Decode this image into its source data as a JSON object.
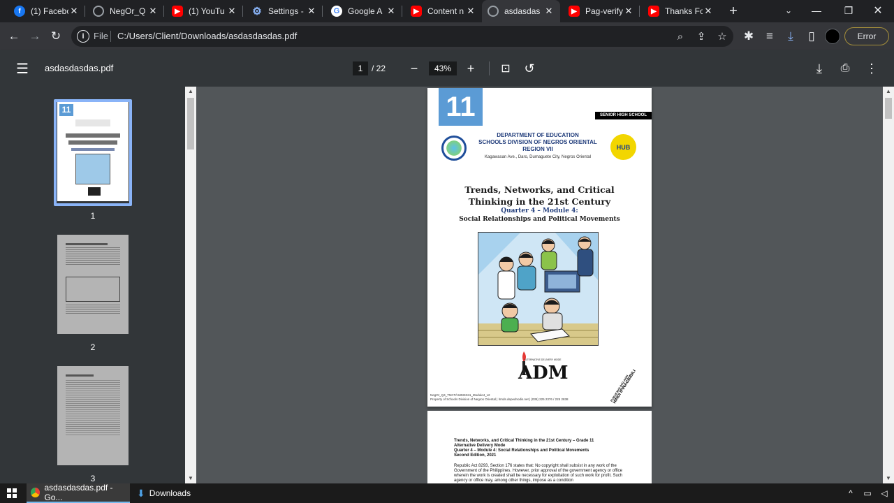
{
  "tabs": [
    {
      "title": "(1) Facebo",
      "icon": "facebook-icon"
    },
    {
      "title": "NegOr_Q",
      "icon": "globe-icon"
    },
    {
      "title": "(1) YouTu",
      "icon": "youtube-icon"
    },
    {
      "title": "Settings -",
      "icon": "gear-icon"
    },
    {
      "title": "Google A",
      "icon": "google-icon"
    },
    {
      "title": "Content n",
      "icon": "youtube-icon"
    },
    {
      "title": "asdasdas",
      "icon": "globe-icon"
    },
    {
      "title": "Pag-verify",
      "icon": "youtube-icon"
    },
    {
      "title": "Thanks Fo",
      "icon": "youtube-icon"
    }
  ],
  "toolbar": {
    "file_label": "File",
    "url": "C:/Users/Client/Downloads/asdasdasdas.pdf",
    "profile_status": "Error"
  },
  "pdf": {
    "filename": "asdasdasdas.pdf",
    "current_page": "1",
    "total_pages": "/ 22",
    "zoom": "43%"
  },
  "thumbnails": [
    "1",
    "2",
    "3"
  ],
  "page1": {
    "grade": "11",
    "level": "SENIOR HIGH SCHOOL",
    "dept_line1": "DEPARTMENT OF EDUCATION",
    "dept_line2": "SCHOOLS DIVISION OF NEGROS ORIENTAL",
    "dept_line3": "REGION VII",
    "address": "Kagawasan Ave., Daro, Dumaguete City, Negros Oriental",
    "title_line1": "Trends, Networks, and Critical",
    "title_line2": "Thinking in the 21st Century",
    "subtitle1": "Quarter 4 – Module 4:",
    "subtitle2": "Social Relationships and Political Movements",
    "adm_tagline": "ALTERNATIVE DELIVERY MODE",
    "adm_logo": "ADM",
    "hub_logo": "HUB",
    "footer_code": "NegOr_Q4_TNCT/HUMSS11_Module4_v2",
    "footer_property": "Property of Schools Division of Negros Oriental    |    lrmds.depednodis.net    |    (035) 225 2376 / 225 2838",
    "stamp_line1": "PUBLIKANG PAG-AARI",
    "stamp_line2": "HINDI IPINAGBIBILI"
  },
  "page2": {
    "line1": "Trends, Networks, and Critical Thinking in the 21st Century – Grade 11",
    "line2": "Alternative Delivery Mode",
    "line3": "Quarter 4 – Module 4: Social Relationships and Political Movements",
    "line4": "Second Edition, 2021",
    "body": "Republic Act 8293, Section 176 states that: No copyright shall subsist in any work of the Government of the Philippines. However, prior approval of the government agency or office wherein the work is created shall be necessary for exploitation of such work for profit. Such agency or office may, among other things, impose as a condition"
  },
  "taskbar": {
    "chrome_task": "asdasdasdas.pdf - Go...",
    "downloads_task": "Downloads"
  },
  "colors": {
    "grade_box": "#5b9bd5",
    "accent_blue": "#8ab4f8",
    "title_blue": "#1f3b7a"
  }
}
